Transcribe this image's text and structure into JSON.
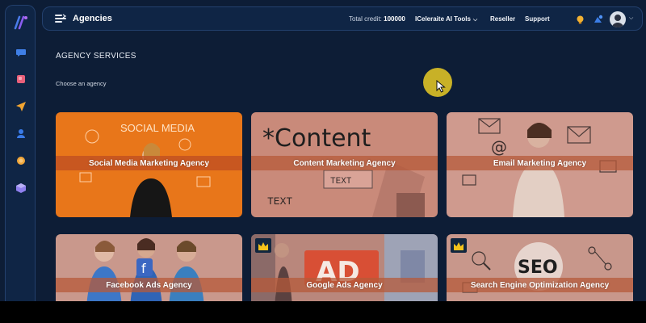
{
  "header": {
    "title": "Agencies",
    "credit_label": "Total credit:",
    "credit_value": "100000",
    "nav": {
      "tools": "ICeleraite AI Tools",
      "reseller": "Reseller",
      "support": "Support"
    }
  },
  "main": {
    "section_title": "AGENCY SERVICES",
    "subtitle": "Choose an agency",
    "cards": [
      {
        "label": "Social Media Marketing Agency",
        "image_text": "SOCIAL MEDIA",
        "premium": false
      },
      {
        "label": "Content Marketing Agency",
        "image_text": "*Content",
        "image_text_2": "TEXT",
        "image_text_3": "TEXT",
        "premium": false
      },
      {
        "label": "Email Marketing Agency",
        "premium": false
      },
      {
        "label": "Facebook Ads Agency",
        "premium": false
      },
      {
        "label": "Google Ads Agency",
        "image_text": "AD",
        "premium": true
      },
      {
        "label": "Search Engine Optimization Agency",
        "image_text": "SEO",
        "premium": true
      }
    ]
  },
  "colors": {
    "background": "#0d1d36",
    "panel": "#0f2545",
    "card_orange": "#e8761a",
    "card_overlay": "#c97a5d",
    "band": "#b55a3a",
    "cursor": "#d8be26"
  }
}
